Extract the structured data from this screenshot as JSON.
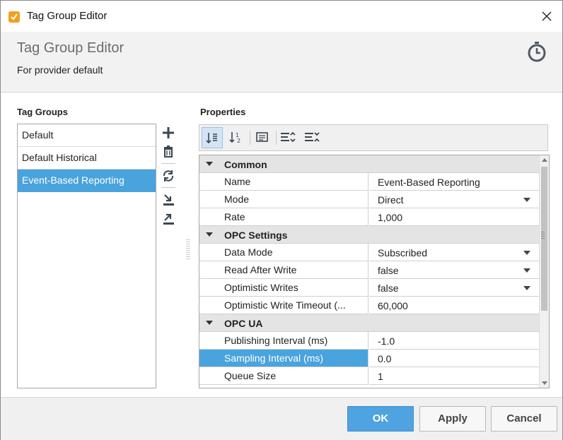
{
  "window": {
    "title": "Tag Group Editor",
    "close_icon": "close-icon"
  },
  "header": {
    "title": "Tag Group Editor",
    "subtitle": "For provider default",
    "icon": "stopwatch-icon"
  },
  "tag_groups": {
    "label": "Tag Groups",
    "items": [
      {
        "label": "Default",
        "selected": false
      },
      {
        "label": "Default Historical",
        "selected": false
      },
      {
        "label": "Event-Based Reporting",
        "selected": true
      }
    ],
    "tools": [
      "add-icon",
      "delete-icon",
      "refresh-icon",
      "import-icon",
      "export-icon"
    ]
  },
  "properties": {
    "label": "Properties",
    "toolbar": [
      "sort-categorized-icon",
      "sort-alphabetical-icon",
      "description-icon",
      "expand-all-icon",
      "collapse-all-icon"
    ],
    "rows": {
      "common": "Common",
      "name": {
        "name": "Name",
        "value": "Event-Based Reporting"
      },
      "mode": {
        "name": "Mode",
        "value": "Direct"
      },
      "rate": {
        "name": "Rate",
        "value": "1,000"
      },
      "opc_settings": "OPC Settings",
      "data_mode": {
        "name": "Data Mode",
        "value": "Subscribed"
      },
      "read_after_write": {
        "name": "Read After Write",
        "value": "false"
      },
      "optimistic_writes": {
        "name": "Optimistic Writes",
        "value": "false"
      },
      "optimistic_write_timeout": {
        "name": "Optimistic Write Timeout (...",
        "value": "60,000"
      },
      "opc_ua": "OPC UA",
      "publishing_interval": {
        "name": "Publishing Interval (ms)",
        "value": "-1.0"
      },
      "sampling_interval": {
        "name": "Sampling Interval (ms)",
        "value": "0.0"
      },
      "queue_size": {
        "name": "Queue Size",
        "value": "1"
      }
    }
  },
  "footer": {
    "ok": "OK",
    "apply": "Apply",
    "cancel": "Cancel"
  },
  "colors": {
    "accent": "#49a3dd",
    "primary_button": "#4ea3e0",
    "app_icon": "#f0a020"
  }
}
